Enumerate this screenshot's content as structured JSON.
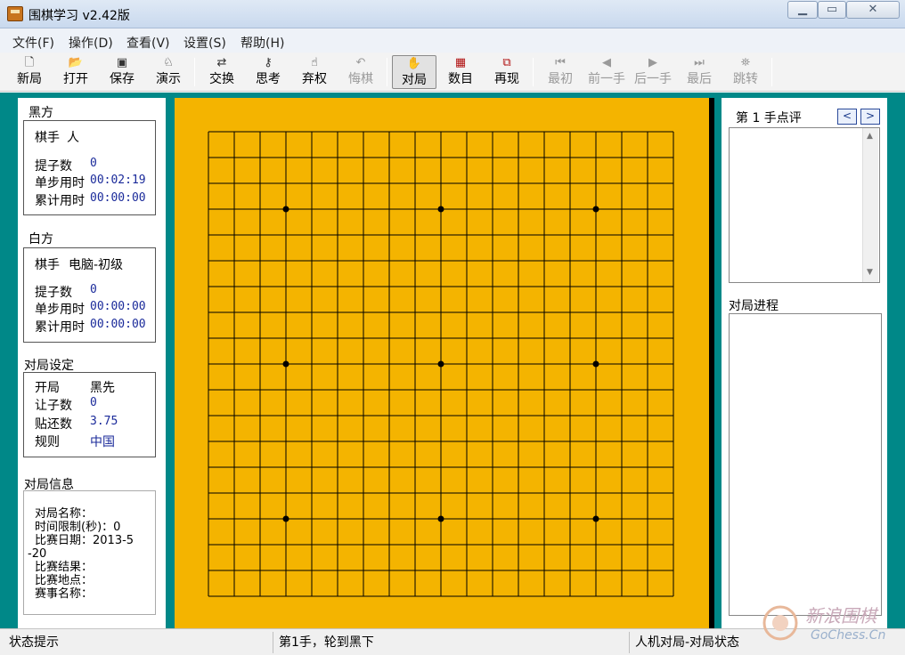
{
  "window": {
    "title": "围棋学习 v2.42版"
  },
  "menu": [
    "文件(F)",
    "操作(D)",
    "查看(V)",
    "设置(S)",
    "帮助(H)"
  ],
  "toolbar": [
    {
      "label": "新局",
      "icon": "new-doc-icon",
      "state": "normal"
    },
    {
      "label": "打开",
      "icon": "open-folder-icon",
      "state": "normal"
    },
    {
      "label": "保存",
      "icon": "save-icon",
      "state": "normal"
    },
    {
      "label": "演示",
      "icon": "demo-icon",
      "state": "normal"
    },
    {
      "label": "交换",
      "icon": "swap-icon",
      "state": "normal"
    },
    {
      "label": "思考",
      "icon": "think-icon",
      "state": "normal"
    },
    {
      "label": "弃权",
      "icon": "pass-icon",
      "state": "normal"
    },
    {
      "label": "悔棋",
      "icon": "undo-icon",
      "state": "disabled"
    },
    {
      "label": "对局",
      "icon": "play-hand-icon",
      "state": "active"
    },
    {
      "label": "数目",
      "icon": "count-icon",
      "state": "normal"
    },
    {
      "label": "再现",
      "icon": "replay-icon",
      "state": "normal"
    },
    {
      "label": "最初",
      "icon": "first-icon",
      "state": "disabled"
    },
    {
      "label": "前一手",
      "icon": "prev-icon",
      "state": "disabled"
    },
    {
      "label": "后一手",
      "icon": "next-icon",
      "state": "disabled"
    },
    {
      "label": "最后",
      "icon": "last-icon",
      "state": "disabled"
    },
    {
      "label": "跳转",
      "icon": "jump-icon",
      "state": "disabled"
    }
  ],
  "black": {
    "title": "黑方",
    "player_label": "棋手",
    "player": "人",
    "captures_label": "提子数",
    "captures": "0",
    "step_time_label": "单步用时",
    "step_time": "00:02:19",
    "total_time_label": "累计用时",
    "total_time": "00:00:00"
  },
  "white": {
    "title": "白方",
    "player_label": "棋手",
    "player": "电脑-初级",
    "captures_label": "提子数",
    "captures": "0",
    "step_time_label": "单步用时",
    "step_time": "00:00:00",
    "total_time_label": "累计用时",
    "total_time": "00:00:00"
  },
  "settings": {
    "title": "对局设定",
    "start_label": "开局",
    "start": "黑先",
    "handicap_label": "让子数",
    "handicap": "0",
    "komi_label": "贴还数",
    "komi": "3.75",
    "rule_label": "规则",
    "rule": "中国"
  },
  "info": {
    "title": "对局信息",
    "lines": [
      "对局名称：",
      "时间限制(秒)：0",
      "比赛日期：2013-5",
      "-20",
      "比赛结果：",
      "比赛地点：",
      "赛事名称："
    ]
  },
  "board": {
    "size": 19,
    "star_points": [
      [
        3,
        3
      ],
      [
        3,
        9
      ],
      [
        3,
        15
      ],
      [
        9,
        3
      ],
      [
        9,
        9
      ],
      [
        9,
        15
      ],
      [
        15,
        3
      ],
      [
        15,
        9
      ],
      [
        15,
        15
      ]
    ]
  },
  "review": {
    "label": "第 1 手点评",
    "prev": "<",
    "next": ">"
  },
  "progress": {
    "title": "对局进程"
  },
  "status": {
    "hint": "状态提示",
    "move": "第1手，轮到黑下",
    "mode": "人机对局-对局状态"
  },
  "watermark": {
    "brand": "新浪围棋",
    "site": "GoChess.Cn"
  }
}
